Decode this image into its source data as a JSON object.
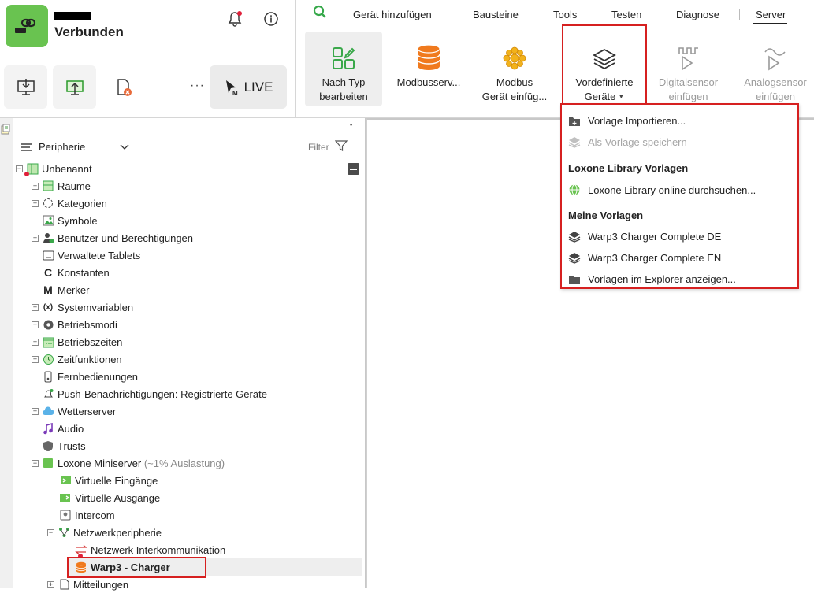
{
  "status": {
    "connection": "Verbunden",
    "live_label": "LIVE",
    "more_label": "···"
  },
  "menu_tabs": [
    "Gerät hinzufügen",
    "Bausteine",
    "Tools",
    "Testen",
    "Diagnose",
    "Server"
  ],
  "ribbon_buttons": [
    {
      "label1": "Nach Typ",
      "label2": "bearbeiten"
    },
    {
      "label1": "Modbusserv...",
      "label2": ""
    },
    {
      "label1": "Modbus",
      "label2": "Gerät einfüg..."
    },
    {
      "label1": "Vordefinierte",
      "label2": "Geräte"
    },
    {
      "label1": "Digitalsensor",
      "label2": "einfügen"
    },
    {
      "label1": "Analogsensor",
      "label2": "einfügen"
    }
  ],
  "tree_header": {
    "title": "Peripherie",
    "filter": "Filter"
  },
  "tree": [
    {
      "label": "Unbenannt",
      "sub": ""
    },
    {
      "label": "Räume",
      "sub": ""
    },
    {
      "label": "Kategorien",
      "sub": ""
    },
    {
      "label": "Symbole",
      "sub": ""
    },
    {
      "label": "Benutzer und Berechtigungen",
      "sub": ""
    },
    {
      "label": "Verwaltete Tablets",
      "sub": ""
    },
    {
      "label": "Konstanten",
      "sub": ""
    },
    {
      "label": "Merker",
      "sub": ""
    },
    {
      "label": "Systemvariablen",
      "sub": ""
    },
    {
      "label": "Betriebsmodi",
      "sub": ""
    },
    {
      "label": "Betriebszeiten",
      "sub": ""
    },
    {
      "label": "Zeitfunktionen",
      "sub": ""
    },
    {
      "label": "Fernbedienungen",
      "sub": ""
    },
    {
      "label": "Push-Benachrichtigungen: Registrierte Geräte",
      "sub": ""
    },
    {
      "label": "Wetterserver",
      "sub": ""
    },
    {
      "label": "Audio",
      "sub": ""
    },
    {
      "label": "Trusts",
      "sub": ""
    },
    {
      "label": "Loxone Miniserver",
      "sub": "(~1% Auslastung)"
    },
    {
      "label": "Virtuelle Eingänge",
      "sub": ""
    },
    {
      "label": "Virtuelle Ausgänge",
      "sub": ""
    },
    {
      "label": "Intercom",
      "sub": ""
    },
    {
      "label": "Netzwerkperipherie",
      "sub": ""
    },
    {
      "label": "Netzwerk Interkommunikation",
      "sub": ""
    },
    {
      "label": "Warp3 - Charger",
      "sub": ""
    },
    {
      "label": "Mitteilungen",
      "sub": ""
    }
  ],
  "dropdown": {
    "import": "Vorlage Importieren...",
    "save": "Als Vorlage speichern",
    "library_head": "Loxone Library Vorlagen",
    "library_search": "Loxone Library online durchsuchen...",
    "mine_head": "Meine Vorlagen",
    "tpl1": "Warp3 Charger Complete DE",
    "tpl2": "Warp3 Charger Complete EN",
    "explorer": "Vorlagen im Explorer anzeigen..."
  },
  "colors": {
    "accent_green": "#69c350",
    "highlight_red": "#d62020",
    "status_dot": "#e0203a"
  }
}
